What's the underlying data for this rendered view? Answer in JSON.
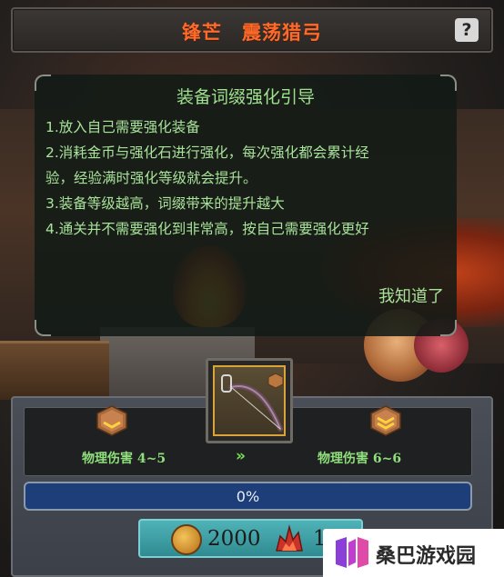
{
  "header": {
    "title": "锋芒　震荡猎弓",
    "help_icon": "question-mark-icon",
    "help_glyph": "?"
  },
  "guide": {
    "title": "装备词缀强化引导",
    "lines": [
      "1.放入自己需要强化装备",
      "2.消耗金币与强化石进行强化，每次强化都会累计经",
      "验，经验满时强化等级就会提升。",
      "3.装备等级越高，词缀带来的提升越大",
      "4.通关并不需要强化到非常高，按自己需要强化更好"
    ],
    "confirm_label": "我知道了"
  },
  "enhance": {
    "item_icon": "bow-icon",
    "current_stat": "物理伤害  4~5",
    "next_stat": "物理伤害  6~6",
    "arrow_glyph": "»",
    "progress_label": "0%",
    "progress_value": 0,
    "gold_cost": "2000",
    "stone_cost": "1"
  },
  "watermark": {
    "text": "桑巴游戏园"
  },
  "colors": {
    "title_orange": "#ff6a2a",
    "guide_green": "#a8e29a",
    "stat_green": "#8fe07a",
    "progress_blue": "#1e3e7a",
    "button_teal": "#2f8b90"
  }
}
